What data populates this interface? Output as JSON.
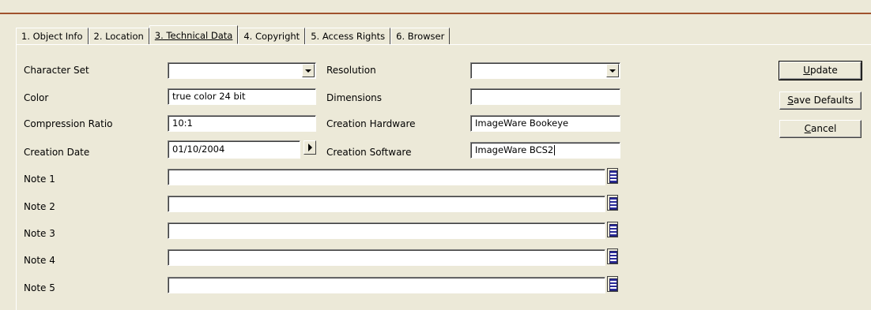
{
  "tabs": [
    {
      "label": "1. Object Info"
    },
    {
      "label": "2. Location"
    },
    {
      "label": "3. Technical Data"
    },
    {
      "label": "4. Copyright"
    },
    {
      "label": "5. Access Rights"
    },
    {
      "label": "6. Browser"
    }
  ],
  "active_tab": "3. Technical Data",
  "form": {
    "character_set": {
      "label": "Character Set",
      "value": ""
    },
    "resolution": {
      "label": "Resolution",
      "value": ""
    },
    "color": {
      "label": "Color",
      "value": "true color 24 bit"
    },
    "dimensions": {
      "label": "Dimensions",
      "value": ""
    },
    "compression_ratio": {
      "label": "Compression Ratio",
      "value": "10:1"
    },
    "creation_hardware": {
      "label": "Creation Hardware",
      "value": "ImageWare Bookeye"
    },
    "creation_date": {
      "label": "Creation Date",
      "value": "01/10/2004"
    },
    "creation_software": {
      "label": "Creation Software",
      "value": "ImageWare BCS2"
    },
    "notes": [
      {
        "label": "Note 1",
        "value": ""
      },
      {
        "label": "Note 2",
        "value": ""
      },
      {
        "label": "Note 3",
        "value": ""
      },
      {
        "label": "Note 4",
        "value": ""
      },
      {
        "label": "Note 5",
        "value": ""
      }
    ]
  },
  "buttons": {
    "update": {
      "mnemonic": "U",
      "rest": "pdate"
    },
    "save_defaults": {
      "mnemonic": "S",
      "rest": "ave Defaults"
    },
    "cancel": {
      "mnemonic": "C",
      "rest": "ancel"
    }
  },
  "colors": {
    "background": "#ECE9D8",
    "accent_line": "#A0522D"
  }
}
